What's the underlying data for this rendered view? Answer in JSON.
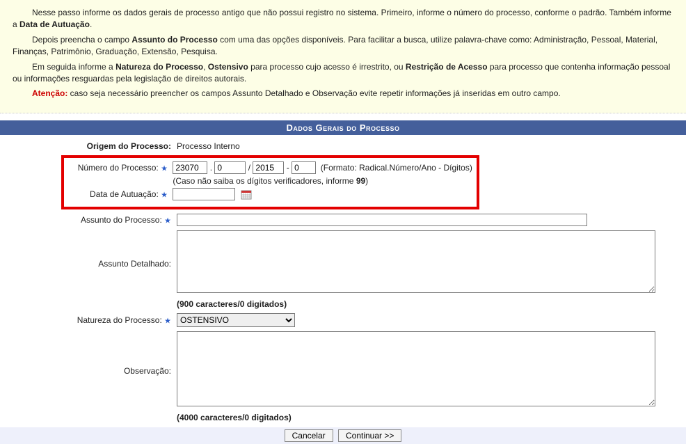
{
  "info": {
    "p1_a": "Nesse passo informe os dados gerais de processo antigo que não possui registro no sistema. Primeiro, informe o número do processo, conforme o padrão. Também informe a ",
    "p1_b": "Data de Autuação",
    "p1_c": ".",
    "p2_a": "Depois preencha o campo ",
    "p2_b": "Assunto do Processo",
    "p2_c": " com uma das opções disponíveis. Para facilitar a busca, utilize palavra-chave como: Administração, Pessoal, Material, Finanças, Patrimônio, Graduação, Extensão, Pesquisa.",
    "p3_a": "Em seguida informe a ",
    "p3_b": "Natureza do Processo",
    "p3_c": ", ",
    "p3_d": "Ostensivo",
    "p3_e": " para processo cujo acesso é irrestrito, ou ",
    "p3_f": "Restrição de Acesso",
    "p3_g": " para processo que contenha informação pessoal ou informações resguardas pela legislação de direitos autorais.",
    "p4_a": "Atenção:",
    "p4_b": " caso seja necessário preencher os campos Assunto Detalhado e Observação evite repetir informações já inseridas em outro campo."
  },
  "section_title": "Dados Gerais do Processo",
  "labels": {
    "origem": "Origem do Processo:",
    "numero": "Número do Processo:",
    "data_autuacao": "Data de Autuação:",
    "assunto": "Assunto do Processo:",
    "assunto_det": "Assunto Detalhado:",
    "natureza": "Natureza do Processo:",
    "observacao": "Observação:"
  },
  "values": {
    "origem": "Processo Interno",
    "num_radical": "23070",
    "num_numero": "0",
    "num_ano": "2015",
    "num_digitos": "0",
    "data_autuacao": "",
    "assunto": "",
    "assunto_det": "",
    "natureza_selected": "OSTENSIVO",
    "observacao": ""
  },
  "hints": {
    "formato": "(Formato: Radical.Número/Ano - Dígitos)",
    "digitos_a": "(Caso não saiba os dígitos verificadores, informe ",
    "digitos_b": "99",
    "digitos_c": ")",
    "assunto_det_counter": "(900 caracteres/0 digitados)",
    "obs_counter": "(4000 caracteres/0 digitados)"
  },
  "sep": {
    "dot": ".",
    "slash": "/",
    "dash": "-"
  },
  "buttons": {
    "cancelar": "Cancelar",
    "continuar": "Continuar >>"
  }
}
